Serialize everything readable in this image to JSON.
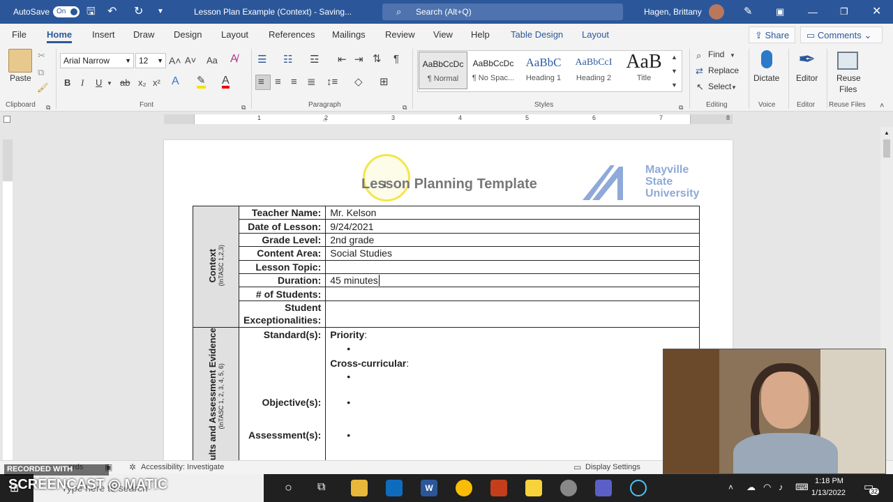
{
  "titlebar": {
    "autosave_label": "AutoSave",
    "autosave_state": "On",
    "doc_title": "Lesson Plan Example (Context)  -  Saving...",
    "search_placeholder": "Search (Alt+Q)",
    "user_name": "Hagen, Brittany"
  },
  "menu": {
    "tabs": [
      "File",
      "Home",
      "Insert",
      "Draw",
      "Design",
      "Layout",
      "References",
      "Mailings",
      "Review",
      "View",
      "Help",
      "Table Design",
      "Layout"
    ],
    "active_tab": "Home",
    "share_label": "Share",
    "comments_label": "Comments"
  },
  "ribbon": {
    "clipboard": {
      "paste_label": "Paste",
      "group_label": "Clipboard"
    },
    "font": {
      "font_name": "Arial Narrow",
      "font_size": "12",
      "group_label": "Font"
    },
    "paragraph": {
      "group_label": "Paragraph"
    },
    "styles": {
      "group_label": "Styles",
      "items": [
        {
          "preview": "AaBbCcDc",
          "name": "¶ Normal"
        },
        {
          "preview": "AaBbCcDc",
          "name": "¶ No Spac..."
        },
        {
          "preview": "AaBbC",
          "name": "Heading 1"
        },
        {
          "preview": "AaBbCcI",
          "name": "Heading 2"
        },
        {
          "preview": "AaB",
          "name": "Title"
        }
      ]
    },
    "editing": {
      "find_label": "Find",
      "replace_label": "Replace",
      "select_label": "Select",
      "group_label": "Editing"
    },
    "voice": {
      "dictate_label": "Dictate",
      "group_label": "Voice"
    },
    "editor": {
      "editor_label": "Editor",
      "group_label": "Editor"
    },
    "reuse": {
      "label_line1": "Reuse",
      "label_line2": "Files",
      "group_label": "Reuse Files"
    }
  },
  "ruler": {
    "marks": [
      "1",
      "2",
      "3",
      "4",
      "5",
      "6",
      "7",
      "8"
    ]
  },
  "document": {
    "heading": "Lesson Planning Template",
    "logo_lines": [
      "Mayville",
      "State",
      "University"
    ],
    "context_label": "Context",
    "context_sub": "(InTASC 1,2,3)",
    "rows": [
      {
        "label": "Teacher Name:",
        "value": "Mr. Kelson"
      },
      {
        "label": "Date of Lesson:",
        "value": "9/24/2021"
      },
      {
        "label": "Grade Level:",
        "value": "2nd grade"
      },
      {
        "label": "Content Area:",
        "value": "Social Studies"
      },
      {
        "label": "Lesson Topic:",
        "value": ""
      },
      {
        "label": "Duration:",
        "value": "45 minutes"
      },
      {
        "label": "# of Students:",
        "value": ""
      },
      {
        "label": "Student Exceptionalities:",
        "value": ""
      }
    ],
    "results_label": "sults and Assessment Evidence",
    "results_sub": "(InTASC 1, 2, 3, 4, 5, 6)",
    "standards_label": "Standard(s):",
    "priority_label": "Priority",
    "crosscurricular_label": "Cross-curricular",
    "objectives_label": "Objective(s):",
    "assessments_label": "Assessment(s):",
    "bullet": "•"
  },
  "statusbar": {
    "recorded_label": "RECORDED WITH",
    "words_label": "ords",
    "accessibility_label": "Accessibility: Investigate",
    "display_settings_label": "Display Settings"
  },
  "taskbar": {
    "brand": "SCREENCAST",
    "brand_suffix": "MATIC",
    "search_placeholder": "Type here to search",
    "time": "1:18 PM",
    "date": "1/13/2022",
    "notifications": "32"
  },
  "colors": {
    "word_blue": "#2b579a",
    "highlight_yellow": "#f2e64d"
  }
}
